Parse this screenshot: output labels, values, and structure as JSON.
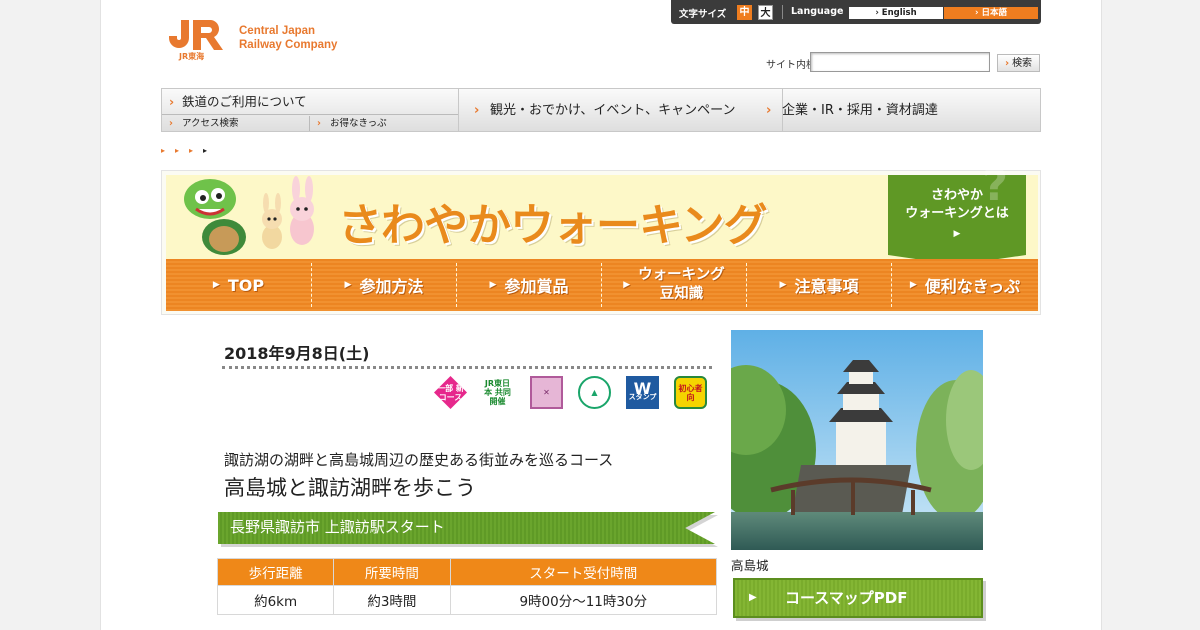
{
  "header": {
    "logo_mark": "JR",
    "logo_text_line1": "Central Japan",
    "logo_text_line2": "Railway Company",
    "logo_sub": "JR東海"
  },
  "utility": {
    "font_size_label": "文字サイズ",
    "font_mid": "中",
    "font_large": "大",
    "language_label": "Language",
    "lang_en": "English",
    "lang_ja": "日本語"
  },
  "search": {
    "label": "サイト内検索",
    "placeholder": "",
    "button": "検索"
  },
  "global_nav": {
    "railway": "鉄道のご利用について",
    "access": "アクセス検索",
    "tickets": "お得なきっぷ",
    "tourism": "観光・おでかけ、イベント、キャンペーン",
    "corporate": "企業・IR・採用・資材調達"
  },
  "banner": {
    "title": "さわやかウォーキング",
    "about_line1": "さわやか",
    "about_line2": "ウォーキングとは",
    "nav": [
      "TOP",
      "参加方法",
      "参加賞品"
    ],
    "nav_trivia_line1": "ウォーキング",
    "nav_trivia_line2": "豆知識",
    "nav_after": [
      "注意事項",
      "便利なきっぷ"
    ]
  },
  "event": {
    "date": "2018年9月8日(土)",
    "tags": {
      "t1": "一部 新コース",
      "t2": "JR東日本 共同開催",
      "t5": "W",
      "t5_sub": "スタンプ",
      "t6": "初心者向"
    },
    "subtitle": "諏訪湖の湖畔と高島城周辺の歴史ある街並みを巡るコース",
    "title": "高島城と諏訪湖畔を歩こう",
    "area": "長野県諏訪市 上諏訪駅スタート",
    "table": {
      "headers": [
        "歩行距離",
        "所要時間",
        "スタート受付時間"
      ],
      "row": [
        "約6km",
        "約3時間",
        "9時00分～11時30分"
      ]
    }
  },
  "right": {
    "photo_caption": "高島城",
    "pdf_button": "コースマップPDF"
  },
  "colors": {
    "brand_orange": "#ef7d1f",
    "walk_green": "#5f9825"
  }
}
